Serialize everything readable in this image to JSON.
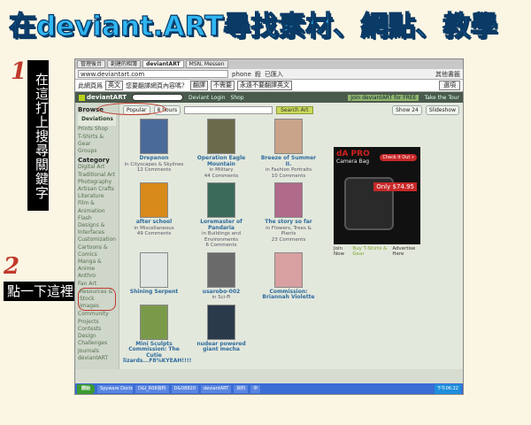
{
  "headline": "在deviant.ART尋找素材、網點、教學",
  "annotations": {
    "step1_number": "1",
    "step1_text": "在這打上搜尋關鍵字",
    "step2_number": "2",
    "step2_text": "點一下這裡"
  },
  "browser": {
    "tabs": [
      "管理後台",
      "創建的相簿",
      "deviantART",
      "MSN, Messen"
    ],
    "address": "www.deviantart.com",
    "addr_extra": [
      "phone",
      "殺",
      "已匯入",
      "其他書籤"
    ],
    "translate_bar": {
      "text1": "此網頁爲",
      "lang": "英文",
      "question": "您要翻譯網頁內容嗎？",
      "translate": "翻譯",
      "no": "不需要",
      "never": "永遠不要翻譯英文",
      "options": "選項"
    }
  },
  "deviantart": {
    "logo": "deviantART",
    "nav": [
      "Deviant Login",
      "Shop"
    ],
    "join": "Join deviantART for FREE",
    "tour": "Take the Tour",
    "sidebar": {
      "browse_header": "Browse",
      "browse_items": [
        "Deviations",
        "Prints Shop",
        "T-Shirts & Gear",
        "Groups"
      ],
      "category_header": "Category",
      "categories": [
        "Digital Art",
        "Traditional Art",
        "Photography",
        "Artisan Crafts",
        "Literature",
        "Film & Animation",
        "Flash",
        "Designs & Interfaces",
        "Customization",
        "Cartoons & Comics",
        "Manga & Anime",
        "Anthro",
        "Fan Art",
        "Resources & Stock Images",
        "Community Projects",
        "Contests",
        "Design Challenges",
        "Journals",
        "deviantART"
      ]
    },
    "filters": {
      "sort": "Popular",
      "time": "8 hours",
      "search_button": "Search Art",
      "show": "Show 24",
      "slideshow": "Slideshow"
    },
    "cards": [
      {
        "title": "Drepanon",
        "cat": "in Cityscapes & Skylines",
        "comments": "12 Comments",
        "color": "#4a6a9a"
      },
      {
        "title": "Operation Eagle Mountain",
        "cat": "in Military",
        "comments": "44 Comments",
        "color": "#6b6a4a"
      },
      {
        "title": "Breeze of Summer II.",
        "cat": "in Fashion Portraits",
        "comments": "10 Comments",
        "color": "#c9a48a"
      },
      {
        "title": "after school",
        "cat": "in Miscellaneous",
        "comments": "49 Comments",
        "color": "#d88a1a"
      },
      {
        "title": "Loremaster of Pandaria",
        "cat": "in Buildings and Environments",
        "comments": "6 Comments",
        "color": "#3a6a5a"
      },
      {
        "title": "The story so far",
        "cat": "in Flowers, Trees & Plants",
        "comments": "23 Comments",
        "color": "#b06a8a"
      },
      {
        "title": "Shining Serpent",
        "cat": "",
        "comments": "",
        "color": "#dfe6e2"
      },
      {
        "title": "usarobo-002",
        "cat": "in Sci-Fi",
        "comments": "",
        "color": "#6a6a6a"
      },
      {
        "title": "Commission: Briannah Violette",
        "cat": "",
        "comments": "",
        "color": "#d8a0a0"
      },
      {
        "title": "Mini Sculpts Commission: The Cutie lizards...F8%KYEAH!!!!",
        "cat": "",
        "comments": "",
        "color": "#7a9a4a"
      },
      {
        "title": "nudear powered giant mecha",
        "cat": "",
        "comments": "",
        "color": "#2a3a4a"
      }
    ],
    "ad": {
      "brand": "dA PRO",
      "product": "Camera Bag",
      "checkout": "Check it Out »",
      "price": "Only $74.95",
      "caption_join": "Join Now",
      "caption_shirts": "Buy T-Shirts & Gear",
      "caption_adv": "Advertise Here"
    }
  },
  "taskbar": {
    "start": "開始",
    "items": [
      "Spyware Doctor",
      "D&I_R08資料",
      "D&D8820",
      "deviantART",
      "資料",
      "中"
    ],
    "clock": "下午06:22"
  }
}
